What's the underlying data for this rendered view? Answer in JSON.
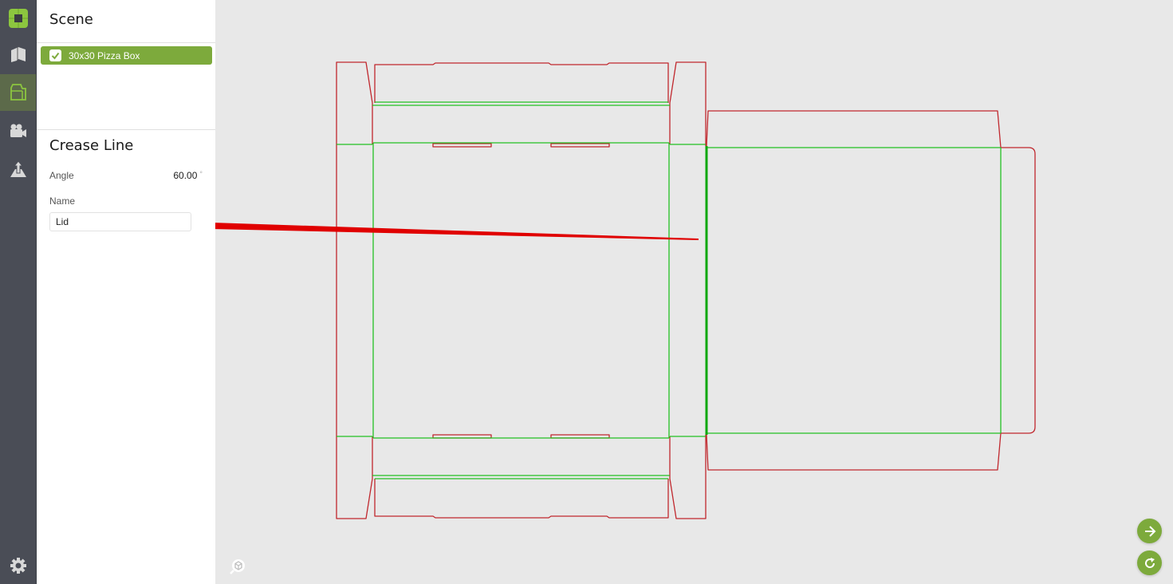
{
  "rail": {
    "items": [
      {
        "name": "logo",
        "icon": "app-logo-icon"
      },
      {
        "name": "structures",
        "icon": "box-structure-icon"
      },
      {
        "name": "dieline",
        "icon": "dieline-icon",
        "active": true
      },
      {
        "name": "camera",
        "icon": "video-camera-icon"
      },
      {
        "name": "export",
        "icon": "upload-icon"
      }
    ],
    "settings_icon": "gear-icon"
  },
  "scene": {
    "title": "Scene",
    "items": [
      {
        "label": "30x30 Pizza Box",
        "checked": true
      }
    ]
  },
  "properties": {
    "title": "Crease Line",
    "angle_label": "Angle",
    "angle_value": "60.00",
    "angle_unit": "°",
    "name_label": "Name",
    "name_value": "Lid"
  },
  "canvas": {
    "cut_color": "#c0272d",
    "crease_color": "#22c022",
    "annotation_arrow_color": "#e00000",
    "buttons": [
      {
        "name": "next-button",
        "icon": "arrow-right-icon"
      },
      {
        "name": "refresh-button",
        "icon": "refresh-icon"
      }
    ],
    "zoom_fit_icon": "zoom-fit-icon"
  },
  "colors": {
    "accent": "#7daa3c",
    "rail_bg": "#4a4d56",
    "canvas_bg": "#e8e8e8"
  }
}
